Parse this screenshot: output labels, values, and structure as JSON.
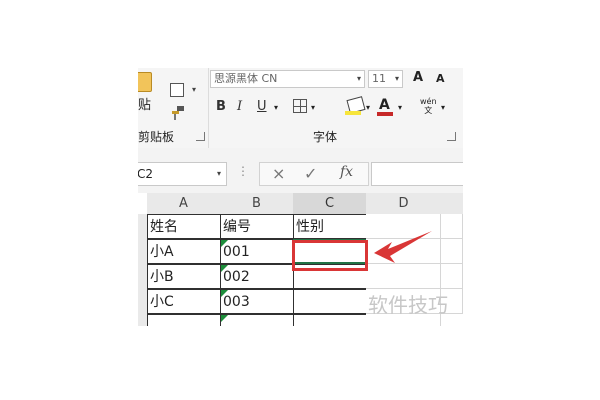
{
  "ribbon": {
    "clipboard": {
      "paste_label": "贴",
      "group_label": "剪贴板"
    },
    "font": {
      "font_name": "思源黑体 CN",
      "font_size": "11",
      "increase": "A",
      "decrease": "A",
      "bold": "B",
      "italic": "I",
      "underline": "U",
      "font_color": "A",
      "phonetic": "wén\n文",
      "group_label": "字体"
    }
  },
  "formula_bar": {
    "name_box": "C2",
    "dots": "⋮",
    "cancel": "×",
    "enter": "✓",
    "fx": "fx",
    "value": ""
  },
  "sheet": {
    "columns": [
      "A",
      "B",
      "C",
      "D"
    ],
    "rows": [
      {
        "A": "姓名",
        "B": "编号",
        "C": "性别",
        "D": ""
      },
      {
        "A": "小A",
        "B": "001",
        "C": "",
        "D": ""
      },
      {
        "A": "小B",
        "B": "002",
        "C": "",
        "D": ""
      },
      {
        "A": "小C",
        "B": "003",
        "C": "",
        "D": ""
      }
    ]
  },
  "watermark": "软件技巧",
  "colors": {
    "accent_green": "#217346",
    "highlight_red": "#d93636",
    "fill_yellow": "#f7e53b",
    "font_red": "#c62828"
  }
}
